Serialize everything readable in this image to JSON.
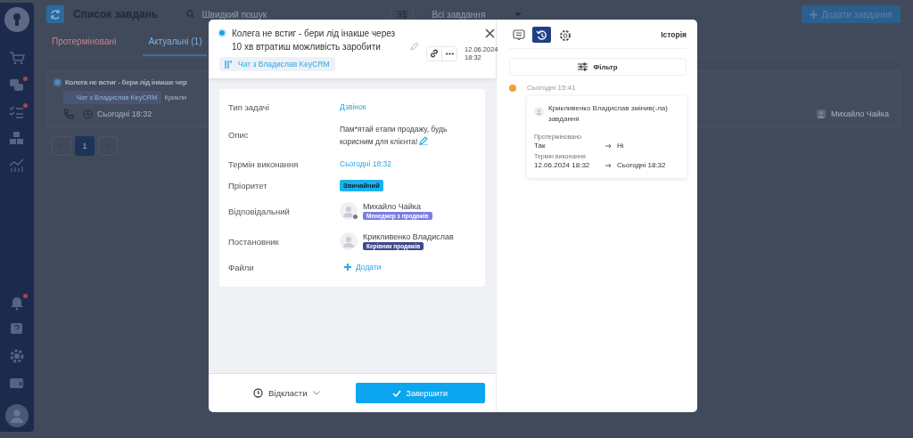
{
  "sidebar": {
    "top": [
      {
        "kind": "cart",
        "badge": false
      },
      {
        "kind": "chat",
        "badge": true
      },
      {
        "kind": "tasks",
        "badge": true
      },
      {
        "kind": "boxes",
        "badge": false
      },
      {
        "kind": "chart",
        "badge": false
      }
    ],
    "bottom": [
      {
        "kind": "bell",
        "badge": true
      },
      {
        "kind": "help",
        "badge": false
      },
      {
        "kind": "gear",
        "badge": false
      },
      {
        "kind": "wallet",
        "badge": false
      }
    ]
  },
  "header": {
    "title": "Список завдань",
    "search_placeholder": "Швидкий пошук",
    "filter_value": "Всі завдання",
    "add_button": "Додати завдання"
  },
  "tabs": [
    {
      "label": "Протерміновані",
      "kind": "overdue",
      "selected": false
    },
    {
      "label": "Актуальні (1)",
      "kind": "current",
      "selected": true
    }
  ],
  "task_card": {
    "checked": true,
    "title": "Колега не встиг - бери лід інакше чер",
    "chat": "Чат з Владислав KeyCRM",
    "author": "Крикли",
    "due": "Сьогодні 18:32",
    "assignee": "Михайло Чайка"
  },
  "pagination": {
    "pages": [
      {
        "label": "1",
        "selected": true
      }
    ]
  },
  "modal": {
    "checked": true,
    "title": "Колега не встиг - бери лід інакше через 10 хв втратиш можливість заробити",
    "date": "12.06.2024 18:32",
    "chat": "Чат з Владислав KeyCRM",
    "fields": [
      {
        "kind": "link",
        "label": "Тип задачі",
        "value": "Дзвінок"
      },
      {
        "kind": "text",
        "label": "Опис",
        "value": "Пам*ятай етапи продажу, будь корисним для клієнта!"
      },
      {
        "kind": "link",
        "label": "Термін виконання",
        "value": "Сьогодні 18:32"
      },
      {
        "kind": "badge",
        "label": "Пріоритет",
        "value": "Звичайний"
      },
      {
        "kind": "person",
        "label": "Відповідальний",
        "name": "Михайло Чайка",
        "role": "Менеджер з продажів",
        "color": "#7b7fe2",
        "online": true
      },
      {
        "kind": "person",
        "label": "Постановник",
        "name": "Крикливенко Владислав",
        "role": "Керівник продажів",
        "color": "#3d4a8c",
        "online": false
      },
      {
        "kind": "add",
        "label": "Файли",
        "value": "Додати"
      }
    ],
    "postpone": "Відкласти",
    "complete": "Завершити"
  },
  "history": {
    "tabs": [
      {
        "kind": "comments",
        "selected": false
      },
      {
        "kind": "history",
        "selected": true
      },
      {
        "kind": "settings",
        "selected": false
      }
    ],
    "title": "Історія",
    "filter": "Фільтр",
    "entries": [
      {
        "time": "Сьогодні 15:41",
        "color": "#f0a232",
        "text": "Крикливенко Владислав змінив(-ла) завдання",
        "changes": [
          {
            "field": "Протерміновано",
            "from": "Так",
            "to": "Ні"
          },
          {
            "field": "Термін виконання",
            "from": "12.06.2024 18:32",
            "to": "Сьогодні 18:32"
          }
        ]
      }
    ]
  }
}
